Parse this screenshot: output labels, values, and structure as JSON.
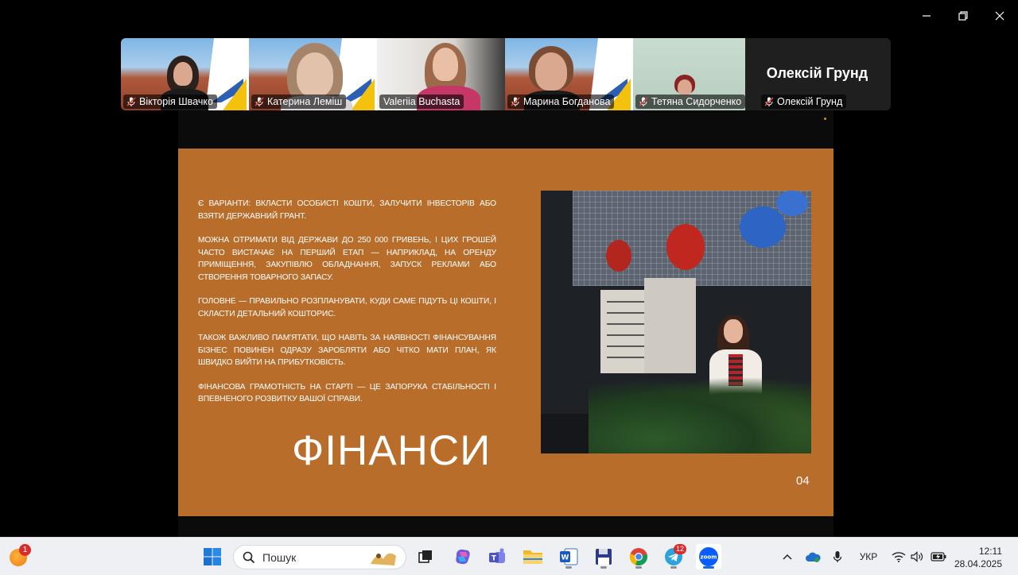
{
  "window": {
    "controls": [
      "minimize",
      "restore",
      "close"
    ]
  },
  "participants": [
    {
      "name": "Вікторія Швачко",
      "muted": true,
      "active": false
    },
    {
      "name": "Катерина Леміш",
      "muted": true,
      "active": false
    },
    {
      "name": "Valeriia Buchasta",
      "muted": false,
      "active": true
    },
    {
      "name": "Марина Богданова",
      "muted": true,
      "active": false
    },
    {
      "name": "Тетяна Сидорченко",
      "muted": true,
      "active": false
    },
    {
      "name": "Олексій Грунд",
      "muted": true,
      "active": false,
      "video_off": true,
      "big_name": "Олексій Грунд"
    }
  ],
  "slide": {
    "paragraphs": [
      "Є варіанти: вкласти особисті кошти, залучити інвесторів або взяти державний грант.",
      "Можна отримати від держави до 250 000 гривень, і цих грошей часто вистачає на перший етап — наприклад, на оренду приміщення, закупівлю обладнання, запуск реклами або створення товарного запасу.",
      "Головне — правильно розпланувати, куди саме підуть ці кошти, і скласти детальний кошторис.",
      "Також важливо пам'ятати, що навіть за наявності фінансування бізнес повинен одразу заробляти або чітко мати план, як швидко вийти на прибутковість.",
      "Фінансова грамотність на старті — це запорука стабільності і впевненого розвитку вашої справи."
    ],
    "title": "ФІНАНСИ",
    "page_number": "04",
    "background_color": "#b96d2b"
  },
  "taskbar": {
    "weather_badge": "1",
    "search_placeholder": "Пошук",
    "telegram_badge": "12",
    "language": "УКР",
    "time": "12:11",
    "date": "28.04.2025"
  }
}
